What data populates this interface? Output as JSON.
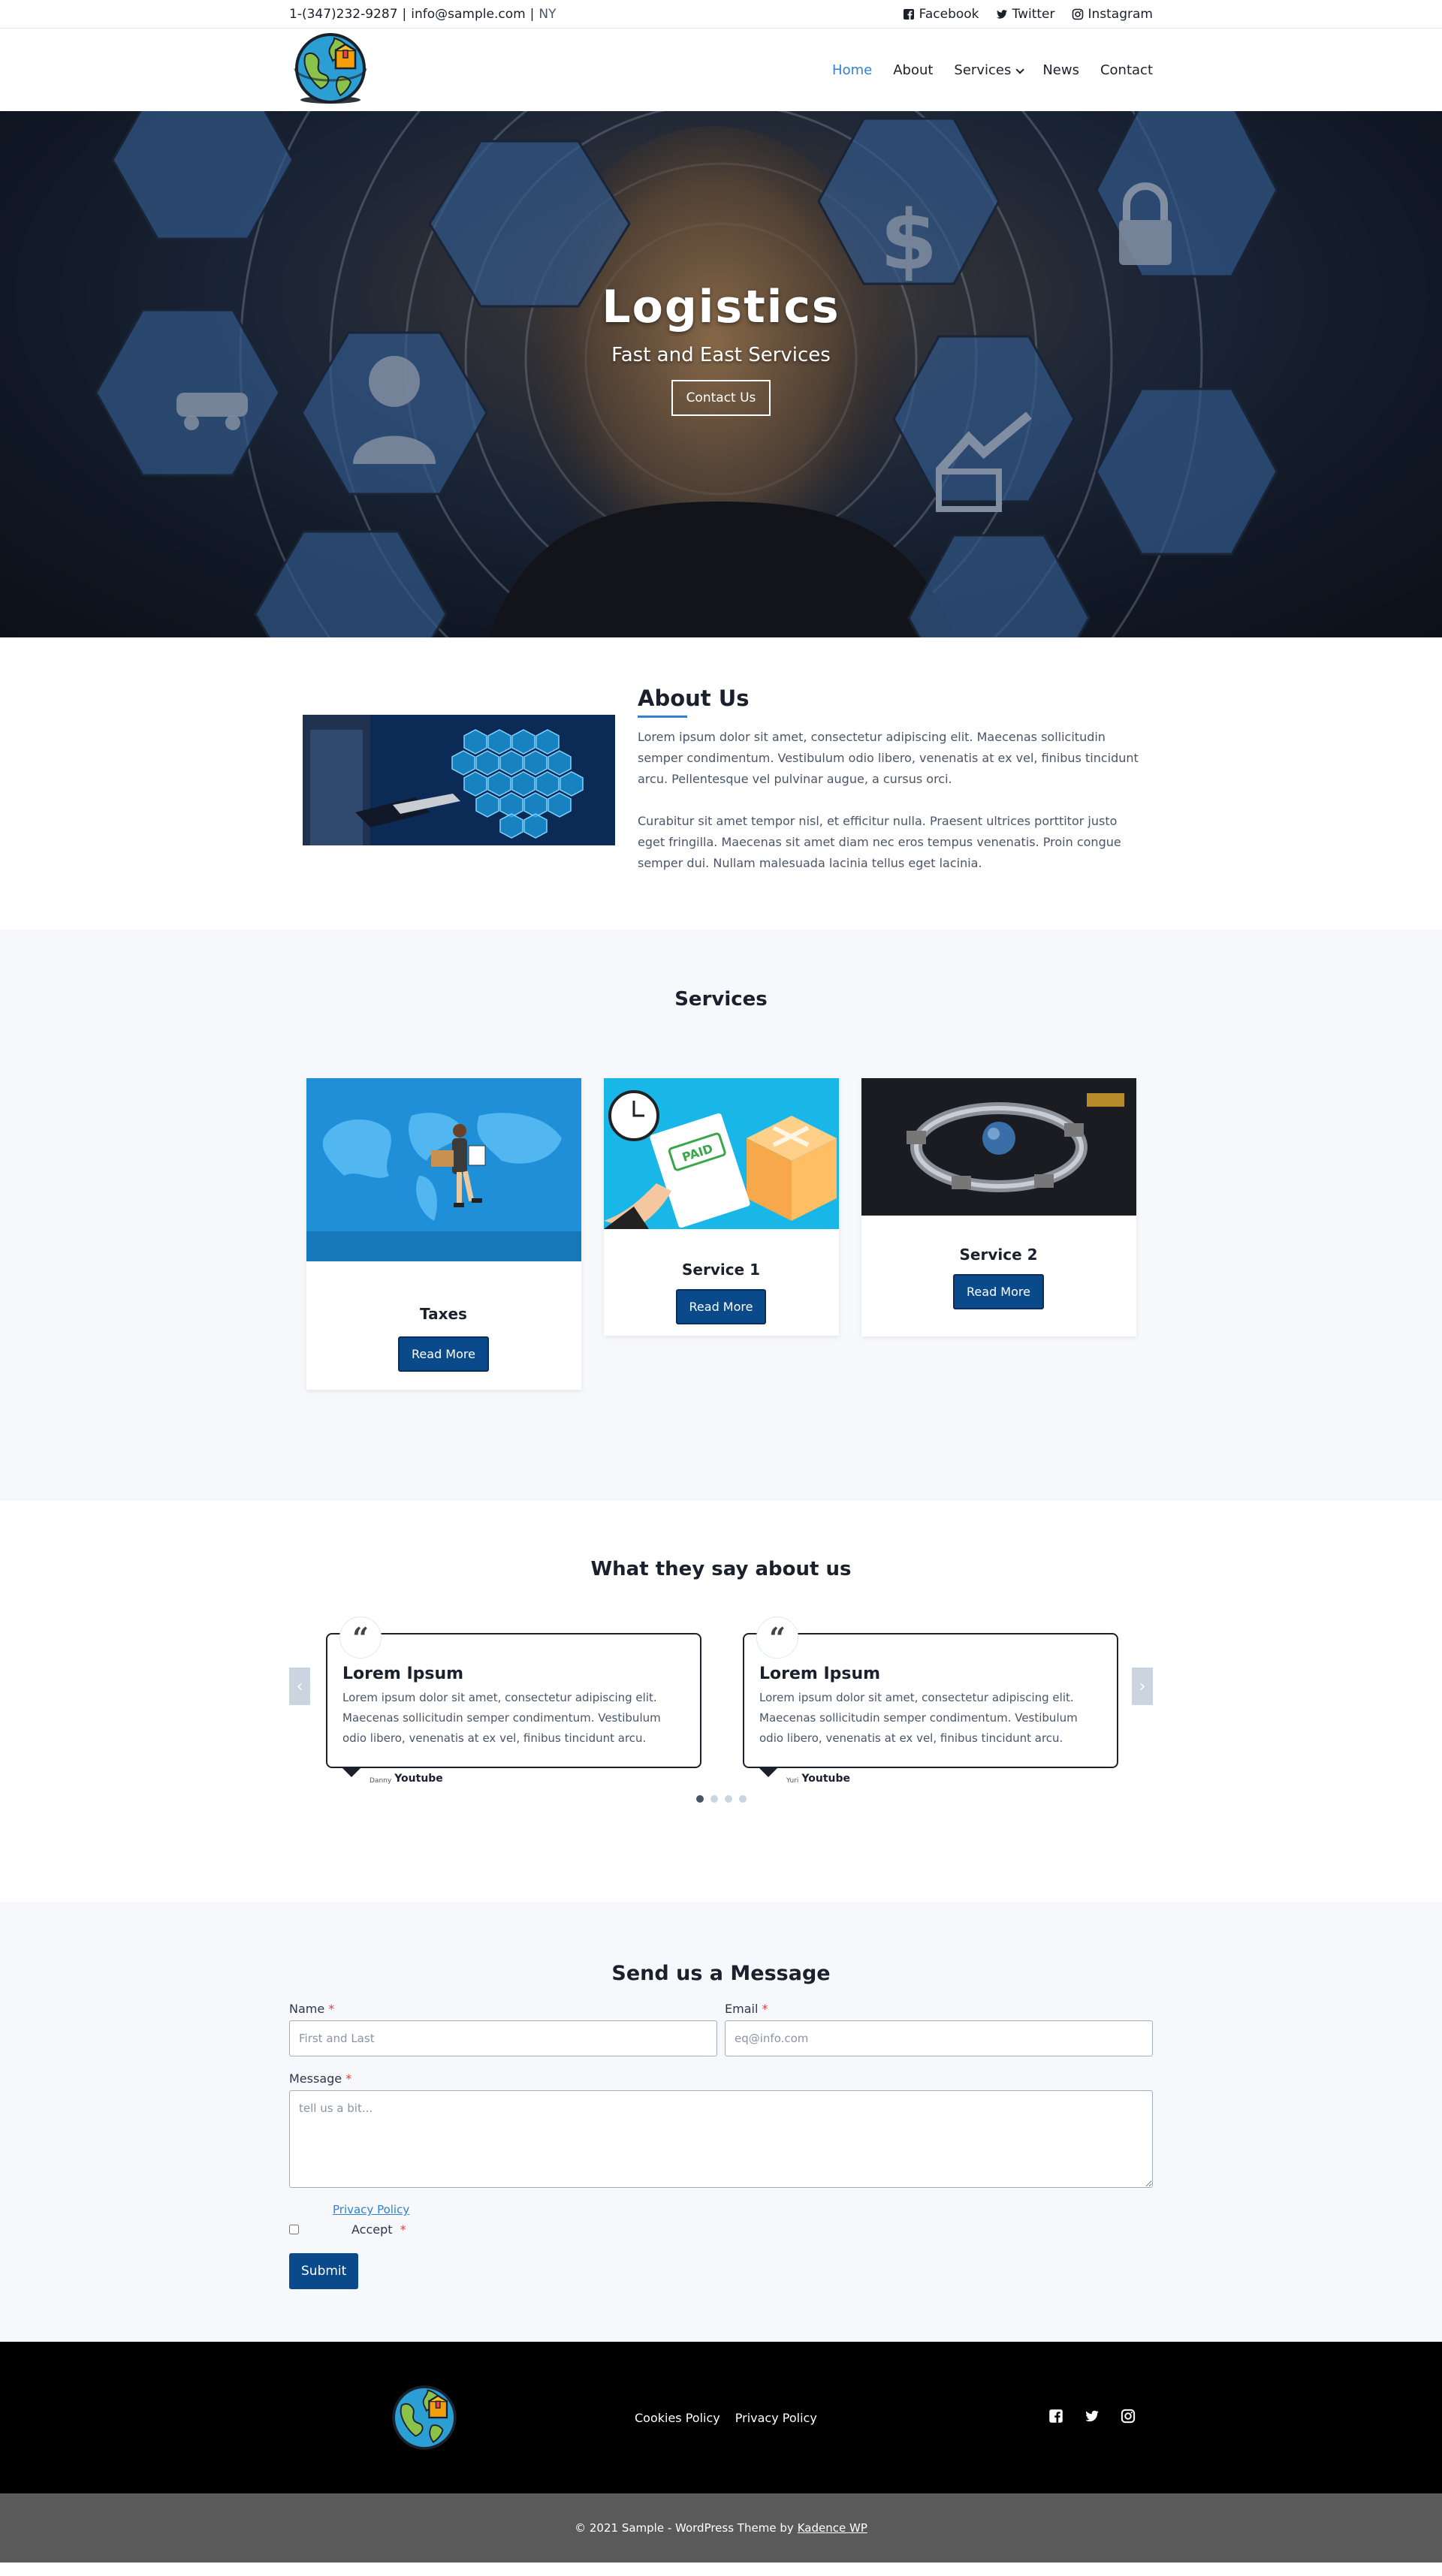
{
  "topbar": {
    "phone": "1-(347)232-9287",
    "email": "info@sample.com",
    "location": "NY",
    "social": [
      {
        "label": "Facebook",
        "icon": "facebook-icon"
      },
      {
        "label": "Twitter",
        "icon": "twitter-icon"
      },
      {
        "label": "Instagram",
        "icon": "instagram-icon"
      }
    ]
  },
  "nav": {
    "items": [
      {
        "label": "Home",
        "active": true
      },
      {
        "label": "About"
      },
      {
        "label": "Services",
        "dropdown": true
      },
      {
        "label": "News"
      },
      {
        "label": "Contact"
      }
    ]
  },
  "hero": {
    "title": "Logistics",
    "subtitle": "Fast and East Services",
    "button": "Contact Us"
  },
  "about": {
    "title": "About Us",
    "paragraphs": [
      "Lorem ipsum dolor sit amet, consectetur adipiscing elit. Maecenas sollicitudin semper condimentum. Vestibulum odio libero, venenatis at ex vel, finibus tincidunt arcu. Pellentesque vel pulvinar augue, a cursus orci.",
      "Curabitur sit amet tempor nisl, et efficitur nulla. Praesent ultrices porttitor justo eget fringilla. Maecenas sit amet diam nec eros tempus venenatis. Proin congue semper dui. Nullam malesuada lacinia tellus eget lacinia."
    ]
  },
  "services": {
    "title": "Services",
    "cards": [
      {
        "title": "Taxes",
        "button": "Read More"
      },
      {
        "title": "Service 1",
        "button": "Read More"
      },
      {
        "title": "Service 2",
        "button": "Read More"
      }
    ]
  },
  "testimonials": {
    "title": "What they say about us",
    "items": [
      {
        "title": "Lorem Ipsum",
        "text": "Lorem ipsum dolor sit amet, consectetur adipiscing elit. Maecenas sollicitudin semper condimentum. Vestibulum odio libero, venenatis at ex vel, finibus tincidunt arcu.",
        "name": "Danny",
        "source": "Youtube"
      },
      {
        "title": "Lorem Ipsum",
        "text": "Lorem ipsum dolor sit amet, consectetur adipiscing elit. Maecenas sollicitudin semper condimentum. Vestibulum odio libero, venenatis at ex vel, finibus tincidunt arcu.",
        "name": "Yuri",
        "source": "Youtube"
      }
    ],
    "dots": 4,
    "active_dot": 0
  },
  "form": {
    "title": "Send us a Message",
    "name_label": "Name",
    "name_placeholder": "First and Last",
    "email_label": "Email",
    "email_placeholder": "eq@info.com",
    "message_label": "Message",
    "message_placeholder": "tell us a bit...",
    "required_mark": "*",
    "policy_link": "Privacy Policy",
    "accept_label": "Accept",
    "submit": "Submit"
  },
  "footer": {
    "links": [
      "Cookies Policy",
      "Privacy Policy"
    ],
    "icons": [
      "facebook-icon",
      "twitter-icon",
      "instagram-icon"
    ],
    "copyright": "© 2021 Sample - WordPress Theme by",
    "credit_link": "Kadence WP"
  },
  "colors": {
    "accent": "#3182ce",
    "button": "#0a4a8a",
    "footer": "#000000",
    "bottom_bar": "#5a5a5a"
  }
}
